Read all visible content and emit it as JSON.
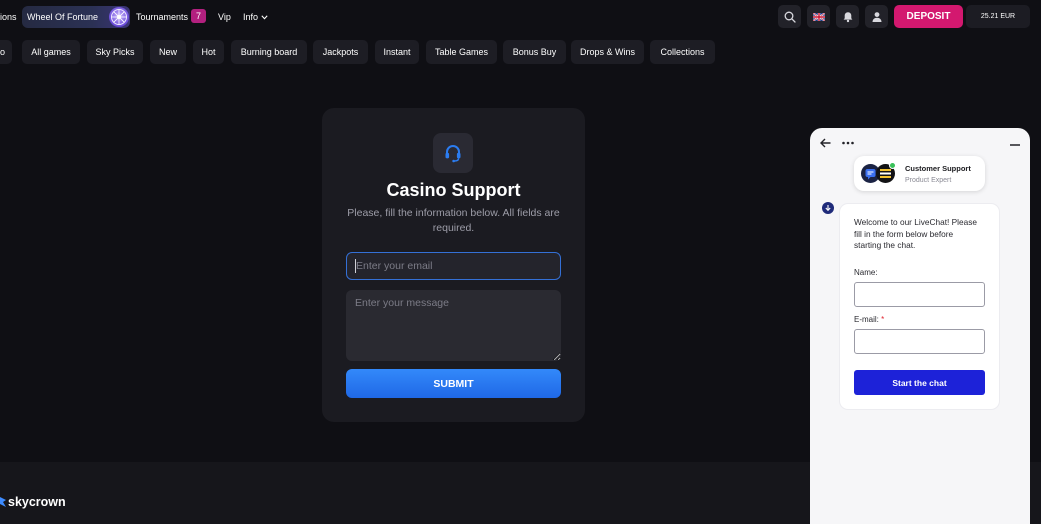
{
  "nav": {
    "clipped_item": "ions",
    "wheel_of_fortune": "Wheel Of Fortune",
    "tournaments": "Tournaments",
    "tournaments_badge": "7",
    "vip": "Vip",
    "info": "Info",
    "deposit": "DEPOSIT",
    "balance": "25.21 EUR"
  },
  "categories": [
    "o",
    "All games",
    "Sky Picks",
    "New",
    "Hot",
    "Burning board",
    "Jackpots",
    "Instant",
    "Table Games",
    "Bonus Buy",
    "Drops & Wins",
    "Collections"
  ],
  "support": {
    "title": "Casino Support",
    "description": "Please, fill the information below. All fields are required.",
    "email_placeholder": "Enter your email",
    "message_placeholder": "Enter your message",
    "submit": "SUBMIT"
  },
  "footer": {
    "brand": "skycrown"
  },
  "livechat": {
    "agent_name": "Customer Support",
    "agent_role": "Product Expert",
    "welcome_message": "Welcome to our LiveChat! Please fill in the form below before starting the chat.",
    "name_label": "Name:",
    "email_label": "E-mail:",
    "required_mark": "*",
    "start_button": "Start the chat"
  },
  "icons": {
    "wheel": "wheel-of-fortune-icon",
    "info_chevron": "chevron-down-icon",
    "search": "search-icon",
    "language": "uk-flag-icon",
    "notifications": "bell-icon",
    "account": "user-icon",
    "support": "headset-icon",
    "brand": "skycrown-logo-icon",
    "chat_back": "arrow-left-icon",
    "chat_menu": "more-dots-icon",
    "chat_minimize": "minimize-icon",
    "chat_bot": "bot-avatar-icon"
  },
  "colors": {
    "page_background": "#0f0f14",
    "card_background": "#1b1b21",
    "pill_background": "#1d1d24",
    "deposit_accent": "#d3186f",
    "badge_accent": "#b3207f",
    "primary_blue": "#2b7cf0",
    "chat_button": "#1d22d8",
    "required_red": "#e0242f",
    "online_green": "#3ac15a"
  }
}
